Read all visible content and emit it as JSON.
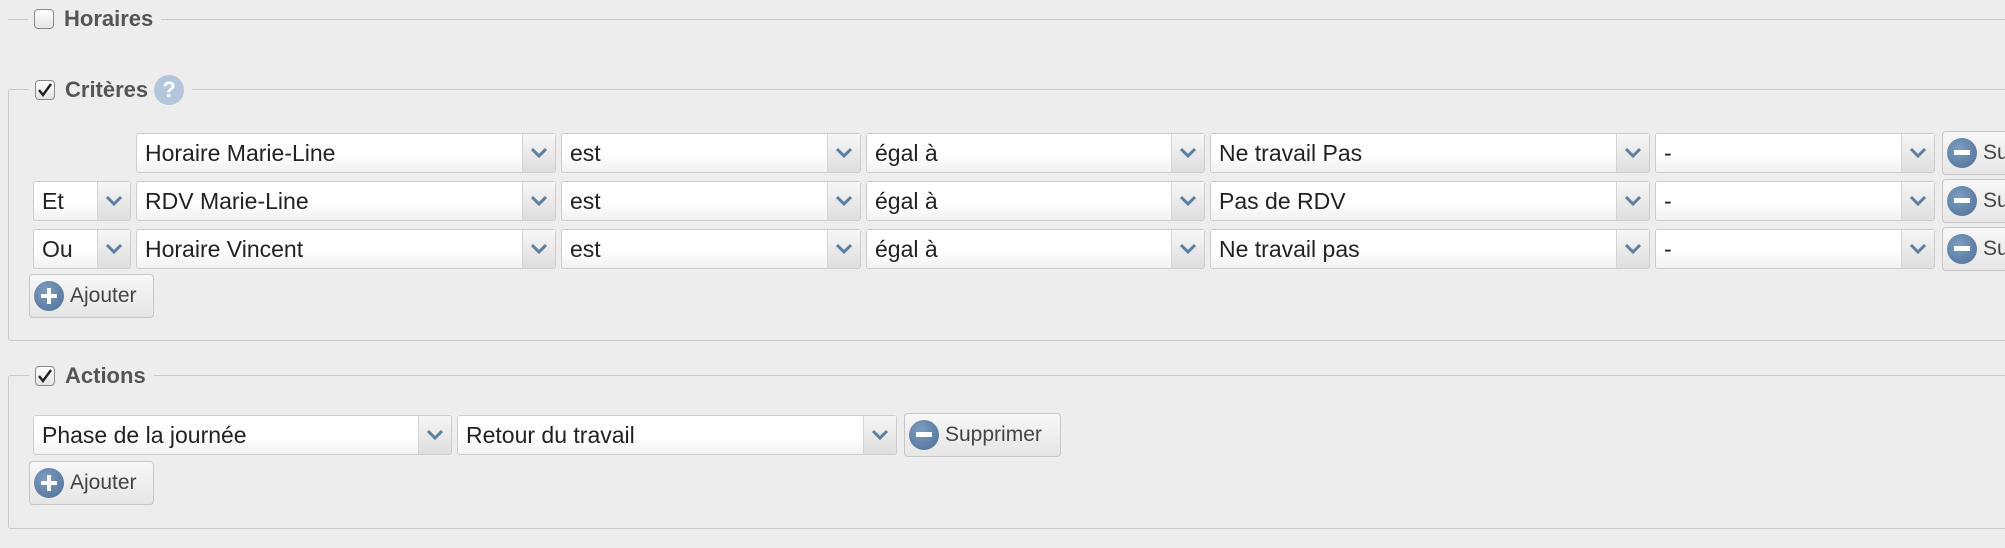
{
  "horaires": {
    "label": "Horaires",
    "checked": false
  },
  "criteres": {
    "label": "Critères",
    "checked": true,
    "help_icon": "question-icon",
    "rows": [
      {
        "connector": "",
        "field": "Horaire Marie-Line",
        "op1": "est",
        "op2": "égal à",
        "value": "Ne travail Pas",
        "extra": "-",
        "remove_label": "Su"
      },
      {
        "connector": "Et",
        "field": "RDV Marie-Line",
        "op1": "est",
        "op2": "égal à",
        "value": "Pas de RDV",
        "extra": "-",
        "remove_label": "Su"
      },
      {
        "connector": "Ou",
        "field": "Horaire Vincent",
        "op1": "est",
        "op2": "égal à",
        "value": "Ne travail pas",
        "extra": "-",
        "remove_label": "Su"
      }
    ],
    "add_label": "Ajouter"
  },
  "actions": {
    "label": "Actions",
    "checked": true,
    "rows": [
      {
        "field": "Phase de la journée",
        "value": "Retour du travail",
        "remove_label": "Supprimer"
      }
    ],
    "add_label": "Ajouter"
  },
  "colors": {
    "icon_blue": "#5c7fa3",
    "help_blue": "#b4c6dc",
    "border": "#c9c9c9",
    "background": "#ededed"
  }
}
